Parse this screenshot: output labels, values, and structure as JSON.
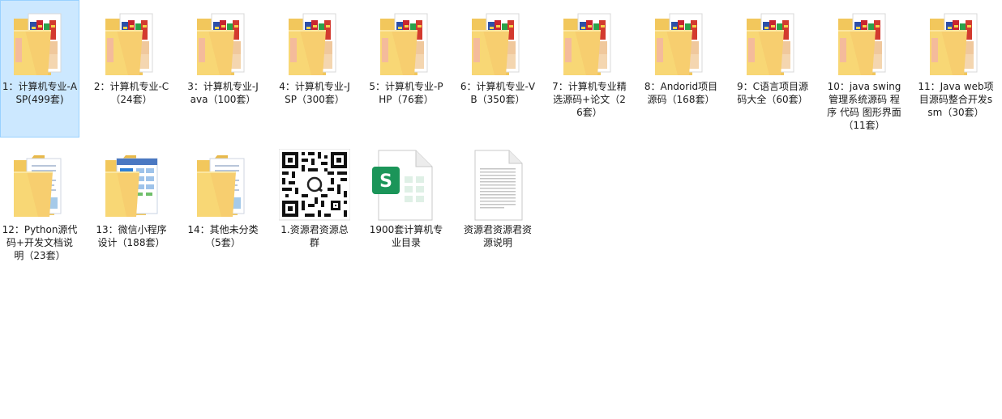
{
  "items": [
    {
      "label": "1：计算机专业-ASP(499套)",
      "icon": "folder-books-icon",
      "selected": true
    },
    {
      "label": "2：计算机专业-C（24套）",
      "icon": "folder-books-icon"
    },
    {
      "label": "3：计算机专业-Java（100套）",
      "icon": "folder-books-icon"
    },
    {
      "label": "4：计算机专业-JSP（300套）",
      "icon": "folder-books-icon"
    },
    {
      "label": "5：计算机专业-PHP（76套）",
      "icon": "folder-books-icon"
    },
    {
      "label": "6：计算机专业-VB（350套）",
      "icon": "folder-books-icon"
    },
    {
      "label": "7：计算机专业精选源码+论文（26套）",
      "icon": "folder-books-icon"
    },
    {
      "label": "8：Andorid项目源码（168套）",
      "icon": "folder-books-icon"
    },
    {
      "label": "9：C语言项目源码大全（60套）",
      "icon": "folder-books-icon"
    },
    {
      "label": "10：java swing 管理系统源码 程序 代码 图形界面（11套）",
      "icon": "folder-books-icon"
    },
    {
      "label": "11：Java web项目源码整合开发ssm（30套）",
      "icon": "folder-books-icon"
    },
    {
      "label": "12：Python源代码+开发文档说明（23套）",
      "icon": "folder-docs-icon"
    },
    {
      "label": "13：微信小程序设计（188套）",
      "icon": "folder-screenshot-icon"
    },
    {
      "label": "14：其他未分类（5套）",
      "icon": "folder-docs-icon"
    },
    {
      "label": "1.资源君资源总群",
      "icon": "qr-code-image-icon"
    },
    {
      "label": "1900套计算机专业目录",
      "icon": "spreadsheet-file-icon"
    },
    {
      "label": "资源君资源君资源说明",
      "icon": "text-document-icon"
    }
  ],
  "colors": {
    "selection": "#cce8ff",
    "selection_border": "#99d1ff",
    "folder": "#f8d775",
    "spreadsheet": "#21a366"
  }
}
